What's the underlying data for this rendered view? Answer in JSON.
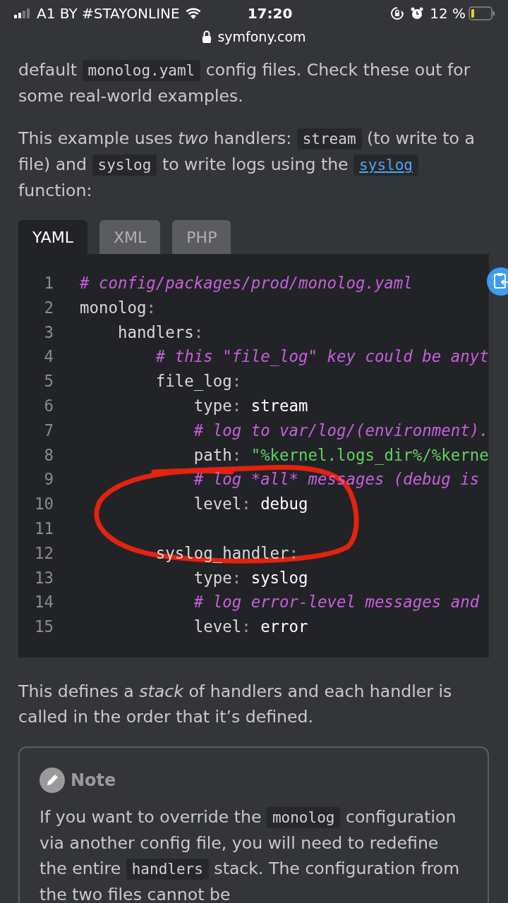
{
  "status_bar": {
    "carrier": "A1 BY #STAYONLINE",
    "time": "17:20",
    "battery": "12 %"
  },
  "address_bar": {
    "url": "symfony.com"
  },
  "intro": [
    {
      "segments": [
        {
          "kind": "text",
          "text": "default "
        },
        {
          "kind": "code",
          "text": "monolog.yaml"
        },
        {
          "kind": "text",
          "text": " config files. Check these out for some real-world examples."
        }
      ]
    },
    {
      "segments": [
        {
          "kind": "text",
          "text": "This example uses *two* handlers: "
        },
        {
          "kind": "code",
          "text": "stream"
        },
        {
          "kind": "text",
          "text": " (to write to a file) and "
        },
        {
          "kind": "code",
          "text": "syslog"
        },
        {
          "kind": "text",
          "text": " to write logs using the "
        },
        {
          "kind": "link",
          "text": "syslog"
        },
        {
          "kind": "text",
          "text": " function:"
        }
      ]
    }
  ],
  "tabs": [
    {
      "label": "YAML",
      "selected": true
    },
    {
      "label": "XML",
      "selected": false
    },
    {
      "label": "PHP",
      "selected": false
    }
  ],
  "code": [
    {
      "number": "1",
      "segments": [
        {
          "kind": "comment",
          "text": "# config/packages/prod/monolog.yaml"
        }
      ]
    },
    {
      "number": "2",
      "segments": [
        {
          "kind": "key",
          "text": "monolog"
        },
        {
          "kind": "punct",
          "text": ":"
        }
      ]
    },
    {
      "number": "3",
      "segments": [
        {
          "kind": "key",
          "text": "    handlers"
        },
        {
          "kind": "punct",
          "text": ":"
        }
      ]
    },
    {
      "number": "4",
      "segments": [
        {
          "kind": "comment",
          "text": "        # this \"file_log\" key could be anyt"
        }
      ]
    },
    {
      "number": "5",
      "segments": [
        {
          "kind": "key",
          "text": "        file_log"
        },
        {
          "kind": "punct",
          "text": ":"
        }
      ]
    },
    {
      "number": "6",
      "segments": [
        {
          "kind": "key",
          "text": "            type"
        },
        {
          "kind": "punct",
          "text": ": "
        },
        {
          "kind": "value",
          "text": "stream"
        }
      ]
    },
    {
      "number": "7",
      "segments": [
        {
          "kind": "comment",
          "text": "            # log to var/log/(environment)."
        }
      ]
    },
    {
      "number": "8",
      "segments": [
        {
          "kind": "key",
          "text": "            path"
        },
        {
          "kind": "punct",
          "text": ": "
        },
        {
          "kind": "string",
          "text": "\"%kernel.logs_dir%/%kerne"
        }
      ]
    },
    {
      "number": "9",
      "segments": [
        {
          "kind": "comment",
          "text": "            # log *all* messages (debug is"
        }
      ]
    },
    {
      "number": "10",
      "segments": [
        {
          "kind": "key",
          "text": "            level"
        },
        {
          "kind": "punct",
          "text": ": "
        },
        {
          "kind": "value",
          "text": "debug"
        }
      ]
    },
    {
      "number": "11"
    },
    {
      "number": "12",
      "segments": [
        {
          "kind": "key",
          "text": "        syslog_handler"
        },
        {
          "kind": "punct",
          "text": ":"
        }
      ]
    },
    {
      "number": "13",
      "segments": [
        {
          "kind": "key",
          "text": "            type"
        },
        {
          "kind": "punct",
          "text": ": "
        },
        {
          "kind": "value",
          "text": "syslog"
        }
      ]
    },
    {
      "number": "14",
      "segments": [
        {
          "kind": "comment",
          "text": "            # log error-level messages and"
        }
      ]
    },
    {
      "number": "15",
      "segments": [
        {
          "kind": "key",
          "text": "            level"
        },
        {
          "kind": "punct",
          "text": ": "
        },
        {
          "kind": "value",
          "text": "error"
        }
      ]
    }
  ],
  "after": [
    {
      "segments": [
        {
          "kind": "text",
          "text": "This defines a *stack* of handlers and each handler is called in the order that it’s defined."
        }
      ]
    }
  ],
  "note": {
    "title": "Note",
    "paragraph": {
      "segments": [
        {
          "kind": "text",
          "text": "If you want to override the "
        },
        {
          "kind": "code",
          "text": "monolog"
        },
        {
          "kind": "text",
          "text": " configuration via another config file, you will need to redefine the entire "
        },
        {
          "kind": "code",
          "text": "handlers"
        },
        {
          "kind": "text",
          "text": " stack. The configuration from the two files cannot be"
        }
      ]
    }
  }
}
